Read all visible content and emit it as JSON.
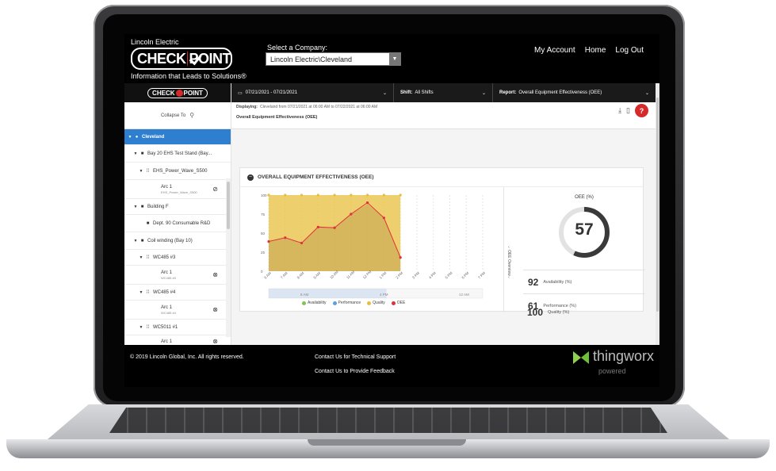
{
  "header": {
    "brand_top": "Lincoln Electric",
    "logo_left": "CHECK",
    "logo_right": "POINT",
    "tagline": "Information that Leads to Solutions®",
    "company_label": "Select a Company:",
    "company_value": "Lincoln Electric\\Cleveland",
    "links": [
      "My Account",
      "Home",
      "Log Out"
    ]
  },
  "sidebar": {
    "logo_left": "CHECK",
    "logo_right": "POINT",
    "collapse_label": "Collapse To",
    "tree": [
      {
        "label": "Cleveland",
        "selected": true
      },
      {
        "label": "Bay 20 EHS Test Stand (Bay..."
      },
      {
        "label": "EHS_Power_Wave_S500"
      },
      {
        "label": "Arc 1",
        "sub": "EHS_Power_Wave_S500"
      },
      {
        "label": "Building F"
      },
      {
        "label": "Dept. 90 Consumable R&D"
      },
      {
        "label": "Coil winding (Bay 10)"
      },
      {
        "label": "WC485 #3"
      },
      {
        "label": "Arc 1",
        "sub": "WC485 #3"
      },
      {
        "label": "WC485 #4"
      },
      {
        "label": "Arc 1",
        "sub": "WC485 #4"
      },
      {
        "label": "WC5011 #1"
      },
      {
        "label": "Arc 1"
      }
    ]
  },
  "filters": {
    "date": "07/21/2021 - 07/21/2021",
    "shift_label": "Shift:",
    "shift_value": "All Shifts",
    "report_label": "Report:",
    "report_value": "Overall Equipment Effectiveness (OEE)"
  },
  "displaying": {
    "label": "Displaying:",
    "text": "Cleveland  from 07/21/2021 at 06:00 AM to 07/22/2021 at 06:00 AM"
  },
  "breadcrumb": "Overall Equipment Effectiveness (OEE)",
  "card": {
    "title": "OVERALL EQUIPMENT EFFECTIVENESS (OEE)",
    "overview_label": "OEE Overview",
    "gauge_title": "OEE (%)",
    "gauge_value": "57",
    "gauge_fraction": 0.57,
    "metrics": [
      {
        "value": "92",
        "label": "Availability (%)"
      },
      {
        "value": "61",
        "label": "Performance (%)"
      },
      {
        "value": "100",
        "label": "Quality (%)"
      }
    ]
  },
  "chart_data": {
    "type": "area",
    "x": [
      "6 AM",
      "7 AM",
      "8 AM",
      "9 AM",
      "10 AM",
      "11 AM",
      "12 PM",
      "1 PM",
      "2 PM",
      "3 PM",
      "4 PM",
      "5 PM",
      "6 PM",
      "7 PM"
    ],
    "yticks": [
      0,
      25,
      50,
      75,
      100
    ],
    "ylim": [
      0,
      100
    ],
    "navigator_labels": [
      "8 AM",
      "4 PM",
      "12 AM"
    ],
    "series": [
      {
        "name": "Availability",
        "color": "#5aa0e0",
        "values": [
          100,
          100,
          100,
          100,
          100,
          100,
          100,
          100,
          100,
          null,
          null,
          null,
          null,
          null
        ]
      },
      {
        "name": "Performance",
        "color": "#6fa3d9",
        "values": [
          40,
          44,
          37,
          58,
          57,
          75,
          88,
          70,
          18,
          null,
          null,
          null,
          null,
          null
        ]
      },
      {
        "name": "Quality",
        "color": "#e8bf3c",
        "values": [
          100,
          100,
          100,
          100,
          100,
          100,
          100,
          100,
          100,
          null,
          null,
          null,
          null,
          null
        ]
      },
      {
        "name": "OEE",
        "color": "#e0303a",
        "values": [
          39,
          44,
          37,
          58,
          57,
          75,
          90,
          70,
          18,
          null,
          null,
          null,
          null,
          null
        ]
      }
    ]
  },
  "footer": {
    "copyright": "© 2019 Lincoln Global, Inc. All rights reserved.",
    "support": "Contact Us for Technical Support",
    "feedback": "Contact Us to Provide Feedback",
    "tw_name": "thingworx",
    "tw_sub": "powered"
  }
}
